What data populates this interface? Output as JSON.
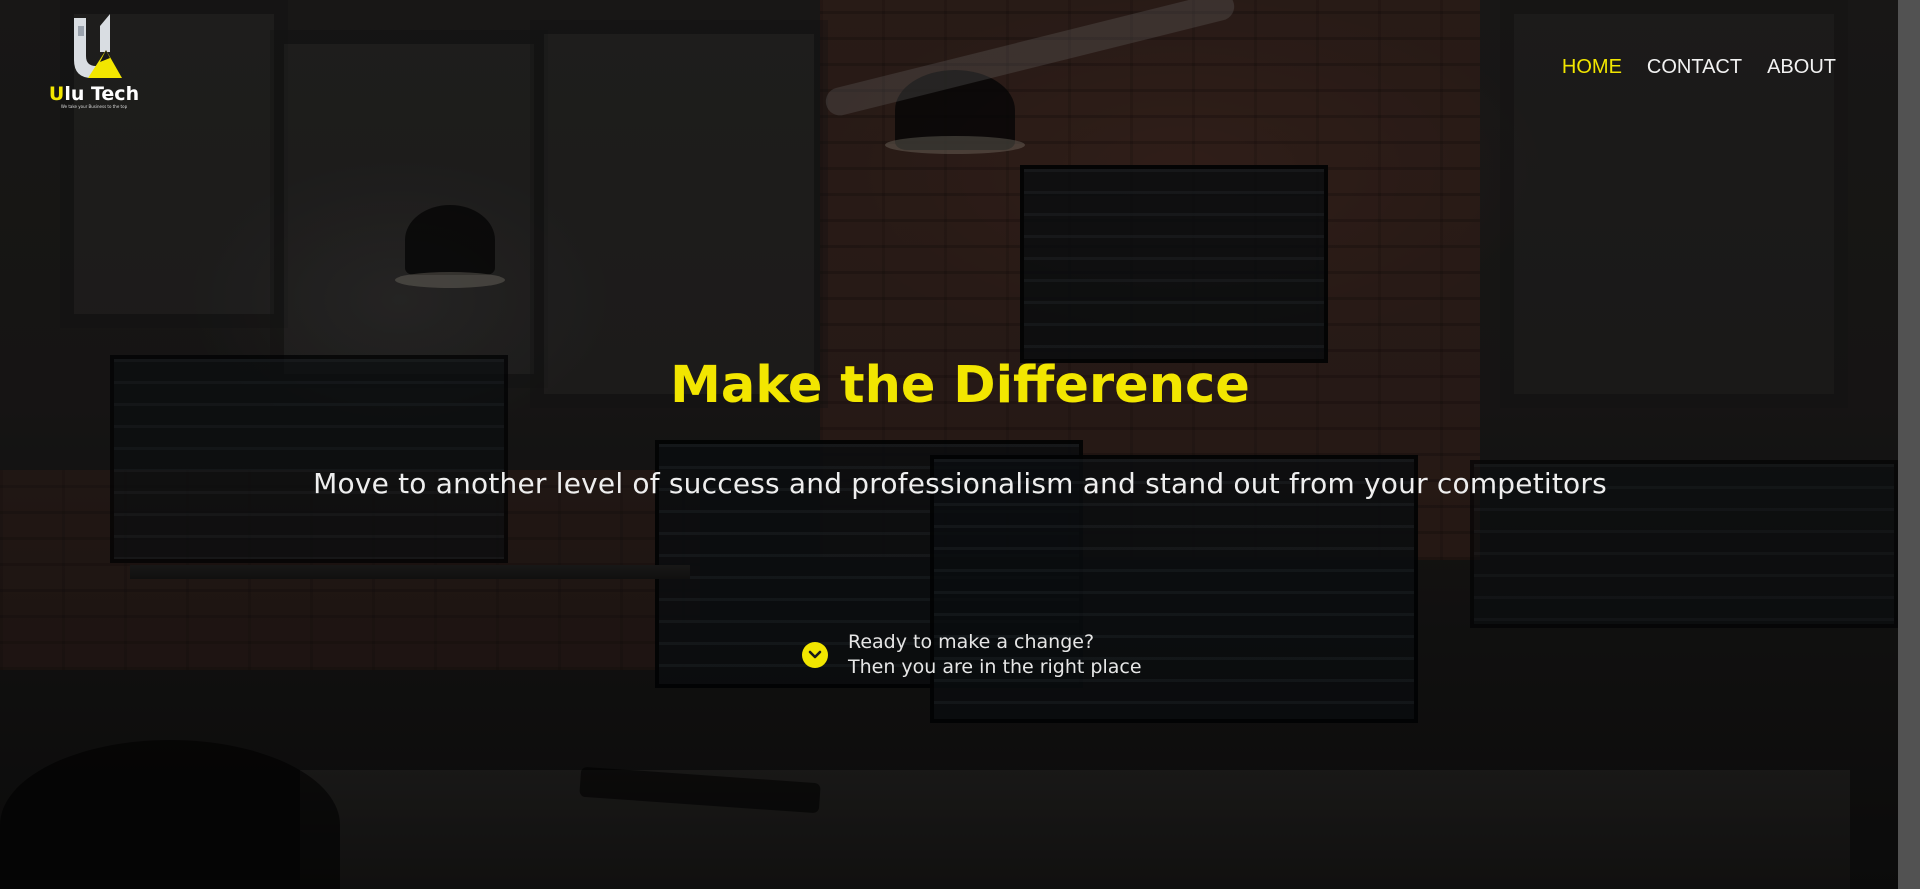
{
  "brand": {
    "name_first_letter": "U",
    "name_rest": "lu Tech",
    "tagline": "We take your Business to the top",
    "logo_icon": "mountain-flag-logo",
    "accent_color": "#f2e600"
  },
  "nav": {
    "items": [
      {
        "label": "HOME",
        "active": true
      },
      {
        "label": "CONTACT",
        "active": false
      },
      {
        "label": "ABOUT",
        "active": false
      }
    ]
  },
  "hero": {
    "title": "Make the Difference",
    "subtitle": "Move to another level of success and professionalism and stand out from your competitors",
    "cta_icon": "chevron-down-icon",
    "cta_line1": "Ready to make a change?",
    "cta_line2": "Then you are in the right place"
  }
}
